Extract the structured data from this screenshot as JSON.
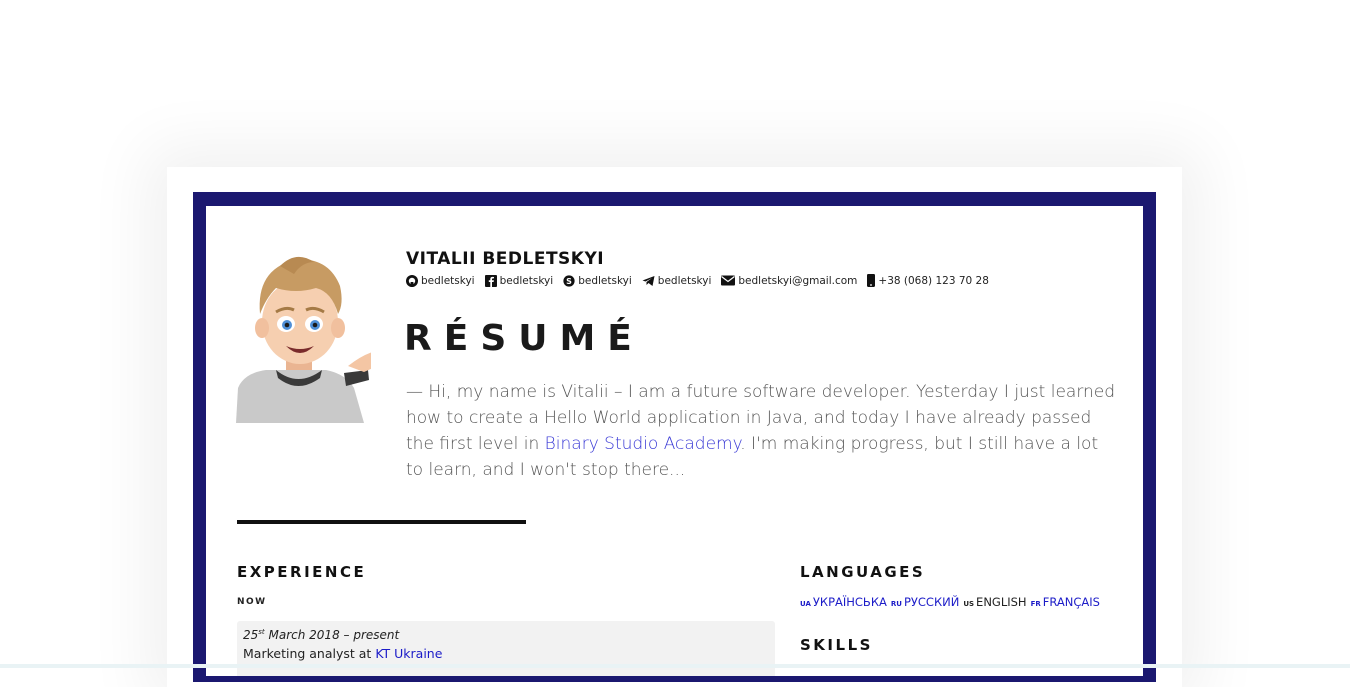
{
  "header": {
    "name": "VITALII BEDLETSKYI",
    "contacts": [
      {
        "icon": "github-icon",
        "text": "bedletskyi"
      },
      {
        "icon": "facebook-icon",
        "text": "bedletskyi"
      },
      {
        "icon": "skype-icon",
        "text": "bedletskyi"
      },
      {
        "icon": "telegram-icon",
        "text": "bedletskyi"
      },
      {
        "icon": "envelope-icon",
        "text": "bedletskyi@gmail.com"
      },
      {
        "icon": "phone-icon",
        "text": "+38 (068) 123 70 28"
      }
    ]
  },
  "title": "RÉSUMÉ",
  "intro": {
    "before_link": "— Hi, my name is Vitalii – I am a future software developer. Yesterday I just learned how to create a Hello World application in Java, and today I have already passed the first level in ",
    "link_text": "Binary Studio Academy",
    "after_link": ". I'm making progress, but I still have a lot to learn, and I won't stop there..."
  },
  "experience": {
    "heading": "EXPERIENCE",
    "subheading": "NOW",
    "jobs": [
      {
        "date_day": "25",
        "date_suffix": "st",
        "date_rest": " March 2018 – present",
        "role": "Marketing analyst at ",
        "company": "KT Ukraine"
      }
    ]
  },
  "languages": {
    "heading": "LANGUAGES",
    "items": [
      {
        "code": "UA",
        "label": "УКРАЇНСЬКА"
      },
      {
        "code": "RU",
        "label": "РУССКИЙ"
      },
      {
        "code": "US",
        "label": "ENGLISH"
      },
      {
        "code": "FR",
        "label": "FRANÇAIS"
      }
    ]
  },
  "skills": {
    "heading": "SKILLS"
  },
  "colors": {
    "frame": "#1b1870",
    "link": "#1c1cc8",
    "card_bg": "#f2f2f2"
  }
}
